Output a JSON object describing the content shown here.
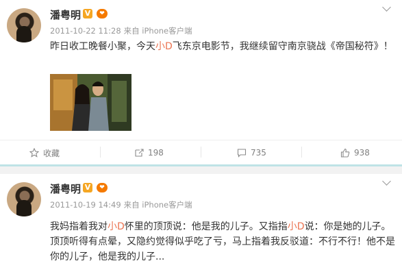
{
  "posts": [
    {
      "author": "潘粤明",
      "verified_badge": "V",
      "level_badge": "❤",
      "timestamp": "2011-10-22 11:28",
      "source": "来自 iPhone客户端",
      "text_before_mention": "昨日收工晚餐小聚，今天",
      "mention": "小D",
      "text_after_mention": "飞东京电影节，我继续留守南京骁战《帝国秘符》！",
      "has_photo": true,
      "actions": {
        "favorite_label": "收藏",
        "repost_count": "198",
        "comment_count": "735",
        "like_count": "938"
      }
    },
    {
      "author": "潘粤明",
      "verified_badge": "V",
      "level_badge": "❤",
      "timestamp": "2011-10-19 14:49",
      "source": "来自 iPhone客户端",
      "text_part1": "我妈指着我对",
      "mention1": "小D",
      "text_part2": "怀里的顶顶说：他是我的儿子。又指指",
      "mention2": "小D",
      "text_part3": "说：你是她的儿子。顶顶听得有点晕，又隐约觉得似乎吃了亏，马上指着我反驳道：不行不行！他不是你的儿子，他是我的儿子..."
    }
  ],
  "colors": {
    "mention": "#eb7350",
    "separator_accent": "#bfe3e6",
    "meta_gray": "#999999"
  },
  "icons": {
    "favorite": "star-icon",
    "repost": "repost-icon",
    "comment": "comment-icon",
    "like": "thumbs-up-icon",
    "menu": "chevron-down-icon"
  }
}
